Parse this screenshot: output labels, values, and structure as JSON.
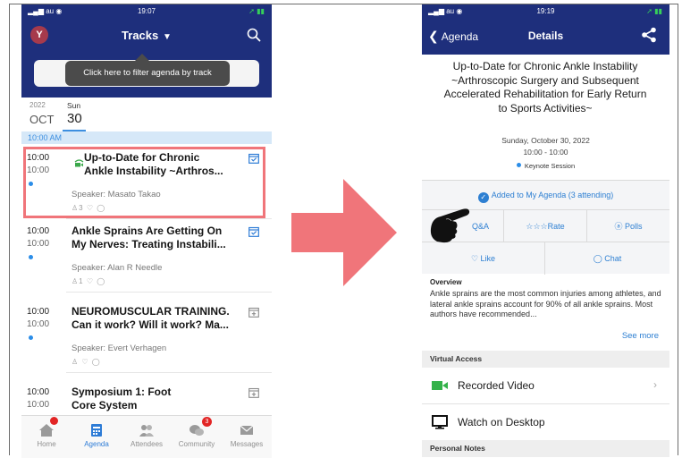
{
  "left_phone": {
    "status": {
      "carrier": "au",
      "time": "19:07"
    },
    "header": {
      "avatar_letter": "Y",
      "title": "Tracks"
    },
    "tooltip": "Click here to filter agenda by track",
    "date": {
      "year": "2022",
      "month": "OCT",
      "weekday": "Sun",
      "day": "30"
    },
    "time_header": "10:00 AM",
    "sessions": [
      {
        "start": "10:00",
        "end": "10:00",
        "title_line1": "Up-to-Date for Chronic",
        "title_line2": "Ankle Instability ~Arthros...",
        "speaker": "Speaker: Masato Takao",
        "stats": "♙3 ♡ ◯",
        "added": true,
        "virtual": true
      },
      {
        "start": "10:00",
        "end": "10:00",
        "title_line1": "Ankle Sprains Are Getting On",
        "title_line2": "My Nerves: Treating Instabili...",
        "speaker": "Speaker: Alan R Needle",
        "stats": "♙1 ♡ ◯",
        "added": true,
        "virtual": false
      },
      {
        "start": "10:00",
        "end": "10:00",
        "title_line1": "NEUROMUSCULAR TRAINING.",
        "title_line2": "Can it work? Will it work? Ma...",
        "speaker": "Speaker: Evert Verhagen",
        "stats": "♙ ♡ ◯",
        "added": false,
        "virtual": false
      },
      {
        "start": "10:00",
        "end": "10:00",
        "title_line1": "Symposium 1: Foot",
        "title_line2": "Core System",
        "speaker": "",
        "stats": "",
        "added": false,
        "virtual": false
      }
    ],
    "tabs": [
      {
        "label": "Home",
        "icon": "home-icon"
      },
      {
        "label": "Agenda",
        "icon": "calendar-icon"
      },
      {
        "label": "Attendees",
        "icon": "attendees-icon"
      },
      {
        "label": "Community",
        "icon": "community-icon",
        "badge": "3"
      },
      {
        "label": "Messages",
        "icon": "envelope-icon"
      }
    ],
    "colors": {
      "nav": "#1e2f7c",
      "highlight": "#f0757a",
      "accent": "#2e7cd6"
    }
  },
  "arrow": {
    "color": "#f0757a"
  },
  "right_phone": {
    "status": {
      "carrier": "au",
      "time": "19:19"
    },
    "header": {
      "back_label": "Agenda",
      "title": "Details"
    },
    "session_title": "Up-to-Date for Chronic Ankle Instability ~Arthroscopic Surgery and Subsequent Accelerated Rehabilitation for Early Return to Sports Activities~",
    "date": "Sunday, October 30, 2022",
    "time": "10:00 - 10:00",
    "session_type": "Keynote Session",
    "added_text": "Added to My Agenda (3 attending)",
    "actions": {
      "qa": "Q&A",
      "rate": "Rate",
      "polls": "Polls",
      "like": "Like",
      "chat": "Chat"
    },
    "overview_heading": "Overview",
    "overview_text": "Ankle sprains are the most common injuries among athletes, and lateral ankle sprains account for 90% of all ankle sprains. Most authors have recommended...",
    "see_more": "See more",
    "virtual_access_heading": "Virtual Access",
    "recorded_video": "Recorded Video",
    "watch_desktop": "Watch on Desktop",
    "personal_notes_heading": "Personal Notes"
  }
}
